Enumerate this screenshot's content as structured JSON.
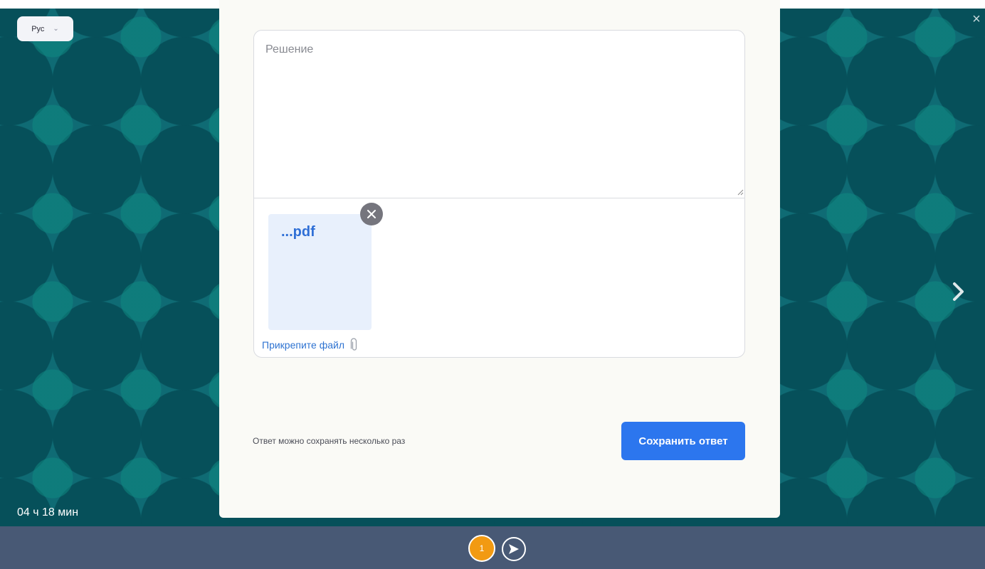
{
  "language": {
    "value": "Рус",
    "chevron_icon": "chevron-down-icon"
  },
  "timer": {
    "text": "04 ч 18 мин"
  },
  "solution": {
    "placeholder": "Решение",
    "value": ""
  },
  "attachment": {
    "file_name": "...pdf",
    "remove_icon": "close-icon"
  },
  "attach": {
    "label": "Прикрепите файл",
    "icon": "paperclip-icon"
  },
  "footer": {
    "hint": "Ответ можно сохранять несколько раз",
    "save_label": "Сохранить ответ"
  },
  "navigation": {
    "next_icon": "chevron-right-icon",
    "close_icon": "close-icon"
  },
  "progress": {
    "current_step": "1",
    "send_icon": "send-icon"
  },
  "colors": {
    "accent": "#2c76ee",
    "current_step": "#f29a12",
    "background_teal": "#0f6b74",
    "bottom_bar": "#485975"
  }
}
